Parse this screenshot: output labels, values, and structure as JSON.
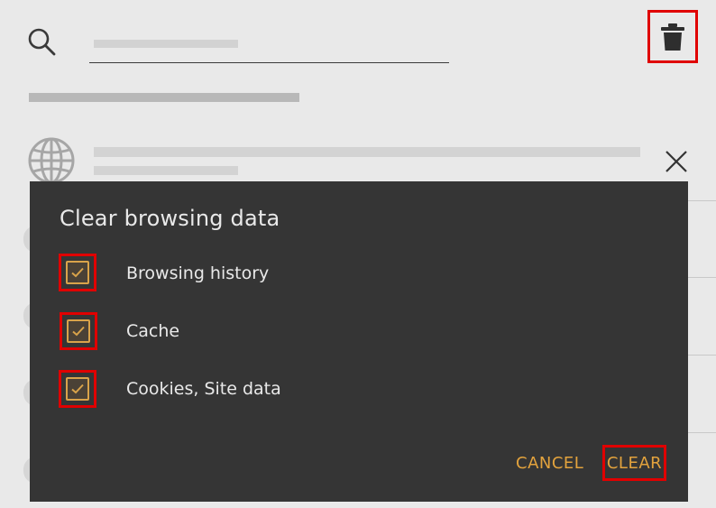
{
  "header": {
    "search_icon": "search-icon",
    "trash_icon": "trash-icon"
  },
  "history": {
    "item_icon": "globe-icon",
    "remove_icon": "close-icon"
  },
  "dialog": {
    "title": "Clear browsing data",
    "options": [
      {
        "label": "Browsing history",
        "checked": true
      },
      {
        "label": "Cache",
        "checked": true
      },
      {
        "label": "Cookies, Site data",
        "checked": true
      }
    ],
    "cancel_label": "CANCEL",
    "clear_label": "CLEAR"
  },
  "colors": {
    "accent": "#e3a33d",
    "dialog_bg": "#353535",
    "page_bg": "#e9e9e9",
    "highlight": "#e00000"
  }
}
